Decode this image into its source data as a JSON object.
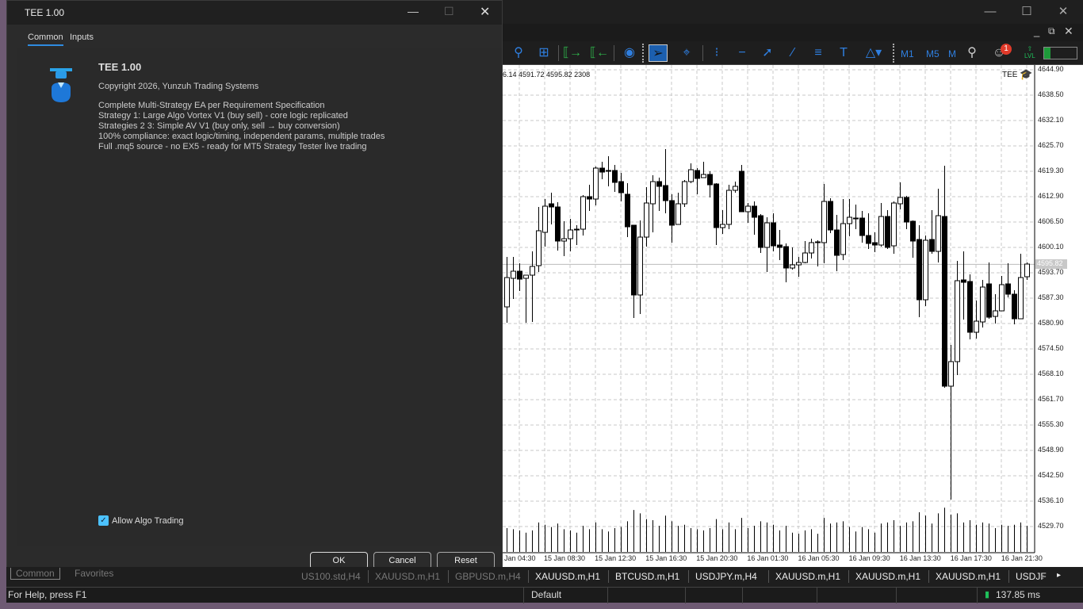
{
  "dialog": {
    "title": "TEE 1.00",
    "tabs": [
      {
        "label": "Common",
        "active": true
      },
      {
        "label": "Inputs",
        "active": false
      }
    ],
    "ea_name": "TEE 1.00",
    "copyright": "Copyright 2026, Yunzuh Trading Systems",
    "description": [
      "Complete Multi-Strategy EA per Requirement Specification",
      "Strategy 1: Large Algo Vortex V1 (buy  sell) - core logic replicated",
      "Strategies 2  3: Simple AV V1 (buy only, sell → buy conversion)",
      "100% compliance: exact logic/timing, independent params, multiple trades",
      "Full .mq5 source - no EX5 - ready for MT5 Strategy Tester  live trading"
    ],
    "allow_algo_label": "Allow Algo Trading",
    "allow_algo_checked": true,
    "buttons": {
      "ok": "OK",
      "cancel": "Cancel",
      "reset": "Reset"
    },
    "icon": "graduation-cap-ea-icon"
  },
  "toolbar": {
    "timeframes": [
      "M1",
      "M5",
      "M"
    ],
    "notification_count": "1",
    "lvl_label": "LVL",
    "accent": "#2f7fe0"
  },
  "chart": {
    "ohlc_header": "6.14 4591.72 4595.82  2308",
    "ea_label": "TEE",
    "current_price": "4595.82",
    "price_ticks": [
      "4644.90",
      "4638.50",
      "4632.10",
      "4625.70",
      "4619.30",
      "4612.90",
      "4606.50",
      "4600.10",
      "4593.70",
      "4587.30",
      "4580.90",
      "4574.50",
      "4568.10",
      "4561.70",
      "4555.30",
      "4548.90",
      "4542.50",
      "4536.10",
      "4529.70"
    ],
    "time_ticks": [
      "Jan 04:30",
      "15 Jan 08:30",
      "15 Jan 12:30",
      "15 Jan 16:30",
      "15 Jan 20:30",
      "16 Jan 01:30",
      "16 Jan 05:30",
      "16 Jan 09:30",
      "16 Jan 13:30",
      "16 Jan 17:30",
      "16 Jan 21:30"
    ]
  },
  "chart_data": {
    "type": "candlestick",
    "ylim": [
      4529.7,
      4644.9
    ],
    "grid": true,
    "bull_color": "#ffffff",
    "bear_color": "#000000",
    "ohlc": [
      [
        4585.1,
        4597.7,
        4581.1,
        4592.5
      ],
      [
        4592.3,
        4597.7,
        4587.1,
        4594.1
      ],
      [
        4594.1,
        4596.1,
        4589.1,
        4592.1
      ],
      [
        4592.3,
        4593.1,
        4581.1,
        4593.1
      ],
      [
        4593.1,
        4599.1,
        4581.3,
        4595.3
      ],
      [
        4595.5,
        4610.3,
        4593.9,
        4604.3
      ],
      [
        4603.9,
        4612.3,
        4600.3,
        4610.5
      ],
      [
        4611.1,
        4613.9,
        4605.9,
        4610.3
      ],
      [
        4610.3,
        4611.5,
        4599.3,
        4601.7
      ],
      [
        4601.7,
        4606.7,
        4597.9,
        4602.3
      ],
      [
        4602.3,
        4607.3,
        4599.1,
        4604.5
      ],
      [
        4604.5,
        4605.7,
        4600.7,
        4604.7
      ],
      [
        4604.7,
        4613.3,
        4603.1,
        4612.9
      ],
      [
        4612.9,
        4615.9,
        4609.3,
        4612.3
      ],
      [
        4612.3,
        4620.5,
        4610.7,
        4620.1
      ],
      [
        4620.1,
        4621.7,
        4617.3,
        4619.1
      ],
      [
        4619.5,
        4623.1,
        4615.5,
        4619.5
      ],
      [
        4619.5,
        4620.9,
        4614.1,
        4616.5
      ],
      [
        4616.7,
        4618.9,
        4611.7,
        4613.9
      ],
      [
        4613.5,
        4616.3,
        4602.7,
        4605.3
      ],
      [
        4605.7,
        4605.7,
        4582.3,
        4588.1
      ],
      [
        4588.1,
        4606.9,
        4583.3,
        4602.7
      ],
      [
        4602.7,
        4615.3,
        4600.3,
        4611.3
      ],
      [
        4611.1,
        4618.3,
        4603.9,
        4616.7
      ],
      [
        4616.7,
        4617.7,
        4609.3,
        4615.5
      ],
      [
        4615.7,
        4624.9,
        4608.7,
        4611.9
      ],
      [
        4611.9,
        4613.5,
        4601.3,
        4605.7
      ],
      [
        4605.9,
        4613.9,
        4605.9,
        4611.1
      ],
      [
        4611.1,
        4617.1,
        4610.3,
        4616.7
      ],
      [
        4616.7,
        4621.3,
        4616.3,
        4619.7
      ],
      [
        4619.5,
        4620.1,
        4613.5,
        4617.5
      ],
      [
        4617.7,
        4621.7,
        4617.7,
        4618.5
      ],
      [
        4618.5,
        4619.3,
        4612.7,
        4615.9
      ],
      [
        4616.1,
        4616.3,
        4600.7,
        4605.1
      ],
      [
        4605.1,
        4609.5,
        4603.5,
        4605.9
      ],
      [
        4605.9,
        4615.9,
        4604.7,
        4614.5
      ],
      [
        4614.5,
        4616.7,
        4613.9,
        4615.5
      ],
      [
        4619.3,
        4620.9,
        4609.1,
        4609.1
      ],
      [
        4609.1,
        4611.3,
        4606.3,
        4610.5
      ],
      [
        4610.5,
        4611.7,
        4603.3,
        4607.7
      ],
      [
        4608.1,
        4608.5,
        4598.7,
        4600.1
      ],
      [
        4600.1,
        4607.7,
        4593.9,
        4606.3
      ],
      [
        4606.3,
        4608.7,
        4599.1,
        4600.5
      ],
      [
        4600.7,
        4604.5,
        4596.9,
        4600.1
      ],
      [
        4600.3,
        4601.1,
        4591.3,
        4594.9
      ],
      [
        4594.9,
        4600.1,
        4594.5,
        4595.7
      ],
      [
        4595.7,
        4597.7,
        4592.7,
        4596.3
      ],
      [
        4596.3,
        4601.7,
        4596.1,
        4598.7
      ],
      [
        4598.7,
        4602.3,
        4597.3,
        4601.3
      ],
      [
        4601.5,
        4601.9,
        4595.3,
        4601.5
      ],
      [
        4601.3,
        4616.1,
        4596.1,
        4611.7
      ],
      [
        4611.7,
        4612.5,
        4603.7,
        4604.5
      ],
      [
        4604.5,
        4608.3,
        4594.1,
        4598.1
      ],
      [
        4598.3,
        4612.3,
        4596.9,
        4606.1
      ],
      [
        4606.1,
        4612.3,
        4602.9,
        4607.7
      ],
      [
        4607.5,
        4610.9,
        4604.7,
        4607.5
      ],
      [
        4607.5,
        4609.3,
        4601.3,
        4603.1
      ],
      [
        4603.1,
        4608.7,
        4599.7,
        4601.1
      ],
      [
        4601.3,
        4603.9,
        4598.9,
        4600.7
      ],
      [
        4600.7,
        4611.3,
        4600.3,
        4607.9
      ],
      [
        4607.9,
        4609.5,
        4599.7,
        4600.1
      ],
      [
        4600.5,
        4611.7,
        4598.5,
        4611.3
      ],
      [
        4611.1,
        4616.5,
        4609.7,
        4612.7
      ],
      [
        4612.7,
        4613.1,
        4604.7,
        4606.5
      ],
      [
        4606.7,
        4606.9,
        4597.5,
        4601.7
      ],
      [
        4602.1,
        4605.7,
        4582.5,
        4586.9
      ],
      [
        4586.9,
        4603.1,
        4585.3,
        4601.9
      ],
      [
        4602.1,
        4609.5,
        4598.5,
        4599.1
      ],
      [
        4599.1,
        4614.9,
        4596.3,
        4608.1
      ],
      [
        4607.9,
        4620.7,
        4564.7,
        4565.1
      ],
      [
        4565.1,
        4575.5,
        4536.5,
        4571.3
      ],
      [
        4571.3,
        4596.7,
        4567.9,
        4591.7
      ],
      [
        4591.9,
        4599.1,
        4581.9,
        4591.3
      ],
      [
        4591.5,
        4593.3,
        4576.9,
        4578.7
      ],
      [
        4578.7,
        4586.7,
        4577.1,
        4581.5
      ],
      [
        4581.3,
        4591.9,
        4579.9,
        4590.1
      ],
      [
        4590.9,
        4596.3,
        4582.1,
        4582.5
      ],
      [
        4582.7,
        4588.3,
        4580.9,
        4584.1
      ],
      [
        4584.1,
        4592.9,
        4584.1,
        4590.7
      ],
      [
        4590.9,
        4596.1,
        4587.5,
        4588.3
      ],
      [
        4588.3,
        4589.3,
        4580.7,
        4582.1
      ],
      [
        4582.1,
        4598.5,
        4582.1,
        4592.5
      ],
      [
        4592.7,
        4596.3,
        4591.9,
        4595.9
      ]
    ],
    "volumes": [
      2100,
      2000,
      1900,
      1700,
      1900,
      2600,
      2400,
      2200,
      2500,
      2000,
      1900,
      1700,
      2300,
      2000,
      2600,
      2000,
      1800,
      2100,
      2200,
      2700,
      3700,
      3400,
      2900,
      2800,
      2300,
      3200,
      2700,
      2300,
      2400,
      2100,
      2000,
      1900,
      2100,
      2900,
      2000,
      2600,
      2000,
      3000,
      2100,
      2300,
      2700,
      2600,
      2400,
      1900,
      2300,
      1700,
      1600,
      1900,
      2000,
      1600,
      3000,
      2500,
      2600,
      2700,
      2200,
      1800,
      2200,
      2000,
      1700,
      2500,
      2600,
      2800,
      2300,
      2600,
      2700,
      3500,
      3200,
      2500,
      3400,
      3900,
      3300,
      3400,
      2600,
      2800,
      2400,
      2600,
      2500,
      2100,
      2400,
      2300,
      2400,
      2600,
      2308
    ]
  },
  "symbol_tabs": [
    "US100.std,H4",
    "XAUUSD.m,H1",
    "GBPUSD.m,H4",
    "XAUUSD.m,H1",
    "BTCUSD.m,H1",
    "USDJPY.m,H4",
    "XAUUSD.m,H1",
    "XAUUSD.m,H1",
    "XAUUSD.m,H1",
    "USDJF"
  ],
  "navigator_tabs": [
    "Common",
    "Favorites"
  ],
  "status": {
    "help": "For Help, press F1",
    "profile": "Default",
    "ping": "137.85 ms"
  }
}
